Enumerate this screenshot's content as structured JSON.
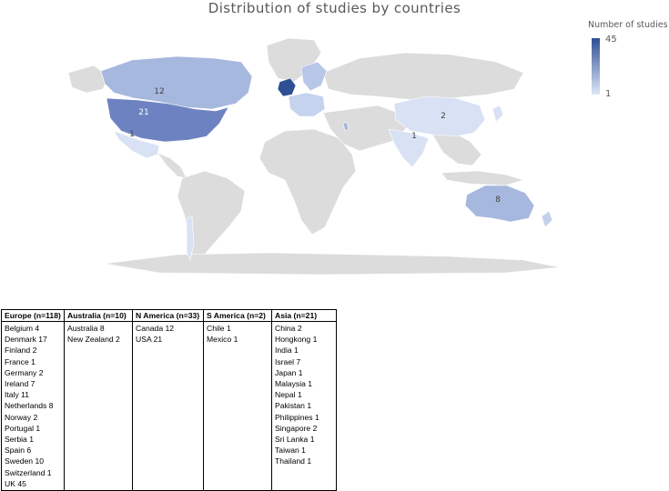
{
  "title": "Distribution of studies by countries",
  "legend": {
    "title": "Number of studies",
    "max": "45",
    "min": "1",
    "color_high": "#2f4f94",
    "color_low": "#dde6f6"
  },
  "map_labels": [
    {
      "region": "Canada",
      "value": "12"
    },
    {
      "region": "USA",
      "value": "21"
    },
    {
      "region": "Mexico",
      "value": "1"
    },
    {
      "region": "China",
      "value": "2"
    },
    {
      "region": "India",
      "value": "1"
    },
    {
      "region": "Australia",
      "value": "8"
    }
  ],
  "table": {
    "columns": [
      {
        "header": "Europe (n=118)",
        "rows": [
          "Belgium 4",
          "Denmark 17",
          "Finland 2",
          "France 1",
          "Germany 2",
          "Ireland 7",
          "Italy 11",
          "Netherlands 8",
          "Norway 2",
          "Portugal 1",
          "Serbia 1",
          "Spain 6",
          "Sweden 10",
          "Switzerland 1",
          "UK 45"
        ]
      },
      {
        "header": "Australia (n=10)",
        "rows": [
          "Australia 8",
          "New Zealand 2"
        ]
      },
      {
        "header": "N America (n=33)",
        "rows": [
          "Canada 12",
          "USA 21"
        ]
      },
      {
        "header": "S America (n=2)",
        "rows": [
          "Chile 1",
          "Mexico 1"
        ]
      },
      {
        "header": "Asia (n=21)",
        "rows": [
          "China 2",
          "Hongkong 1",
          "India 1",
          "Israel 7",
          "Japan 1",
          "Malaysia 1",
          "Nepal 1",
          "Pakistan 1",
          "Philippines 1",
          "Singapore 2",
          "Sri Lanka 1",
          "Taiwan 1",
          "Thailand 1"
        ]
      }
    ]
  }
}
